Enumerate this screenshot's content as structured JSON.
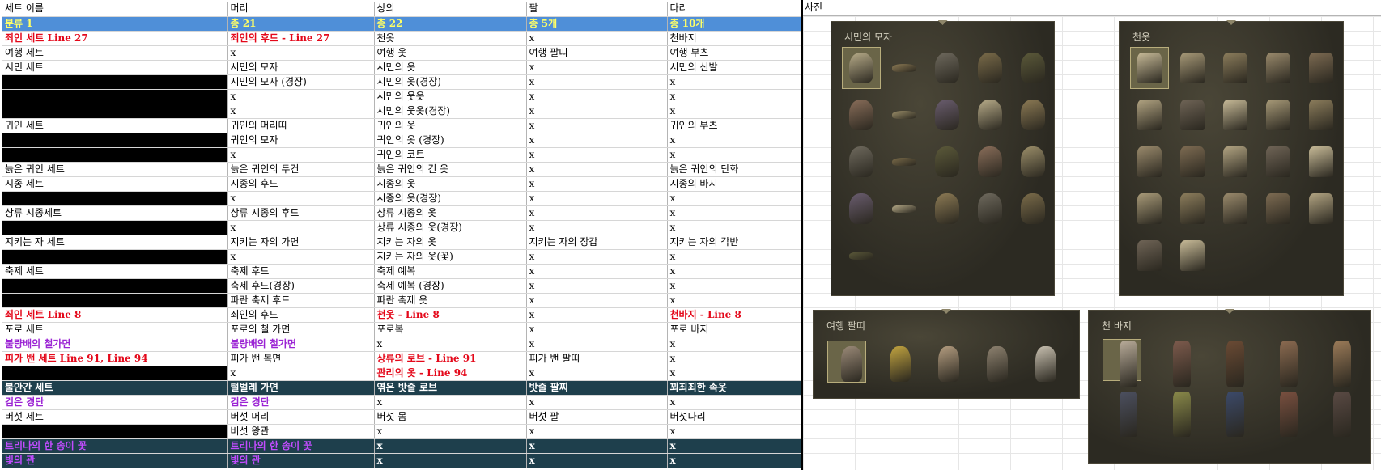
{
  "columns": [
    "세트 이름",
    "머리",
    "상의",
    "팔",
    "다리",
    "사진"
  ],
  "summary": [
    "분류 1",
    "총 21",
    "총 22",
    "총 5개",
    "총 10개"
  ],
  "rows": [
    {
      "style": "red-name",
      "cells": [
        "죄인 세트 Line 27",
        "죄인의 후드 - Line 27",
        "천옷",
        "x",
        "천바지"
      ]
    },
    {
      "style": "",
      "cells": [
        "여행 세트",
        "x",
        "여행 옷",
        "여행 팔띠",
        "여행 부츠"
      ]
    },
    {
      "style": "",
      "cells": [
        "시민 세트",
        "시민의 모자",
        "시민의 옷",
        "x",
        "시민의 신발"
      ]
    },
    {
      "style": "blk",
      "cells": [
        "",
        "시민의 모자 (경장)",
        "시민의 옷(경장)",
        "x",
        "x"
      ]
    },
    {
      "style": "blk",
      "cells": [
        "",
        "x",
        "시민의 웃옷",
        "x",
        "x"
      ]
    },
    {
      "style": "blk",
      "cells": [
        "",
        "x",
        "시민의 웃옷(경장)",
        "x",
        "x"
      ]
    },
    {
      "style": "",
      "cells": [
        "귀인 세트",
        "귀인의 머리띠",
        "귀인의 옷",
        "x",
        "귀인의 부츠"
      ]
    },
    {
      "style": "blk",
      "cells": [
        "",
        "귀인의 모자",
        "귀인의 옷 (경장)",
        "x",
        "x"
      ]
    },
    {
      "style": "blk",
      "cells": [
        "",
        "x",
        "귀인의 코트",
        "x",
        "x"
      ]
    },
    {
      "style": "",
      "cells": [
        "늙은 귀인 세트",
        "늙은 귀인의 두건",
        "늙은 귀인의 긴 옷",
        "x",
        "늙은 귀인의 단화"
      ]
    },
    {
      "style": "",
      "cells": [
        "시종 세트",
        "시종의 후드",
        "시종의 옷",
        "x",
        "시종의 바지"
      ]
    },
    {
      "style": "blk",
      "cells": [
        "",
        "x",
        "시종의 옷(경장)",
        "x",
        "x"
      ]
    },
    {
      "style": "",
      "cells": [
        "상류 시종세트",
        "상류 시종의 후드",
        "상류 시종의 옷",
        "x",
        "x"
      ]
    },
    {
      "style": "blk",
      "cells": [
        "",
        "x",
        "상류 시종의 옷(경장)",
        "x",
        "x"
      ]
    },
    {
      "style": "",
      "cells": [
        "지키는 자 세트",
        "지키는 자의 가면",
        "지키는 자의 옷",
        "지키는 자의 장갑",
        "지키는 자의 각반"
      ]
    },
    {
      "style": "blk",
      "cells": [
        "",
        "x",
        "지키는 자의 옷(꽃)",
        "x",
        "x"
      ]
    },
    {
      "style": "",
      "cells": [
        "축제 세트",
        "축제 후드",
        "축제 예복",
        "x",
        "x"
      ]
    },
    {
      "style": "blk",
      "cells": [
        "",
        "축제 후드(경장)",
        "축제 예복 (경장)",
        "x",
        "x"
      ]
    },
    {
      "style": "blk",
      "cells": [
        "",
        "파란 축제 후드",
        "파란 축제 옷",
        "x",
        "x"
      ]
    },
    {
      "style": "line8",
      "cells": [
        "죄인 세트 Line 8",
        "죄인의 후드",
        "천옷 - Line 8",
        "x",
        "천바지 - Line 8"
      ]
    },
    {
      "style": "",
      "cells": [
        "포로 세트",
        "포로의 철 가면",
        "포로복",
        "x",
        "포로 바지"
      ]
    },
    {
      "style": "purple",
      "cells": [
        "불량배의 철가면",
        "불량배의 철가면",
        "x",
        "x",
        "x"
      ]
    },
    {
      "style": "blood",
      "cells": [
        "피가 밴 세트 Line 91, Line 94",
        "피가 밴 복면",
        "상류의 로브 - Line 91",
        "피가 밴 팔띠",
        "x"
      ]
    },
    {
      "style": "blk-red",
      "cells": [
        "",
        "x",
        "관리의 옷 - Line 94",
        "x",
        "x"
      ]
    },
    {
      "style": "dark",
      "cells": [
        "불안간 세트",
        "털벌레 가면",
        "엮은 밧줄 로브",
        "밧줄 팔찌",
        "꾀죄죄한 속옷"
      ]
    },
    {
      "style": "purple",
      "cells": [
        "검은 경단",
        "검은 경단",
        "x",
        "x",
        "x"
      ]
    },
    {
      "style": "",
      "cells": [
        "버섯 세트",
        "버섯 머리",
        "버섯 몸",
        "버섯 팔",
        "버섯다리"
      ]
    },
    {
      "style": "blk",
      "cells": [
        "",
        "버섯 왕관",
        "x",
        "x",
        "x"
      ]
    },
    {
      "style": "dark-purple",
      "cells": [
        "트리나의 한 송이 꽃",
        "트리나의 한 송이 꽃",
        "x",
        "x",
        "x"
      ]
    },
    {
      "style": "dark-purple",
      "cells": [
        "빛의 관",
        "빛의 관",
        "x",
        "x",
        "x"
      ]
    }
  ],
  "panels": {
    "hats": {
      "title": "시민의 모자"
    },
    "cloth": {
      "title": "천옷"
    },
    "armband": {
      "title": "여행 팔띠"
    },
    "pants": {
      "title": "천 바지"
    }
  },
  "colors": {
    "summary_bg": "#4f8fd8",
    "summary_text": "#ffff66",
    "dark_row": "#1e3f4c",
    "red": "#e4081a",
    "purple": "#9b24d4"
  }
}
